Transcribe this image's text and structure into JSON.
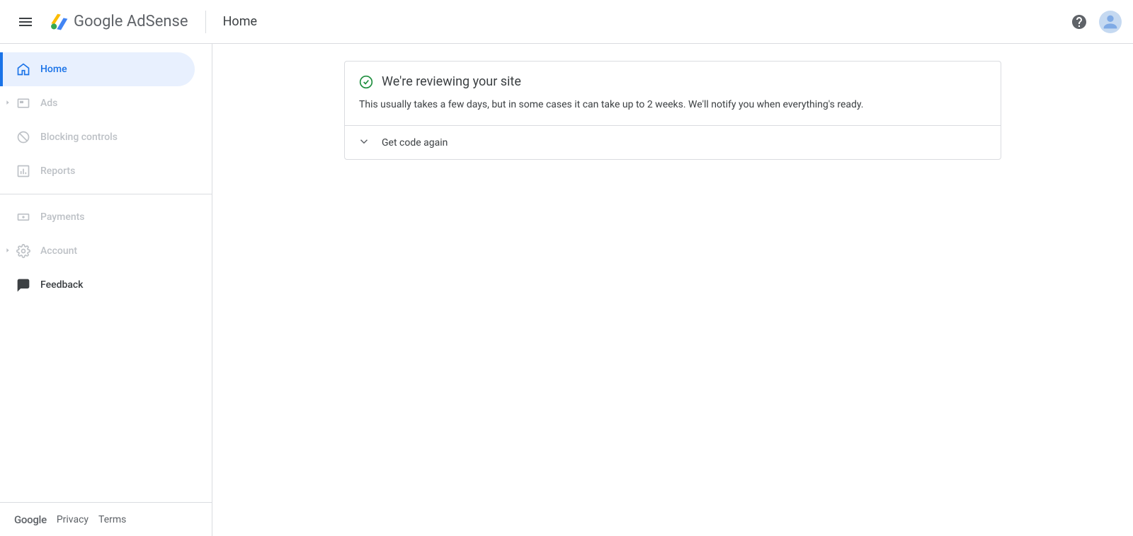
{
  "header": {
    "logo_text_primary": "Google",
    "logo_text_secondary": "AdSense",
    "page_title": "Home"
  },
  "sidebar": {
    "items": [
      {
        "label": "Home"
      },
      {
        "label": "Ads"
      },
      {
        "label": "Blocking controls"
      },
      {
        "label": "Reports"
      },
      {
        "label": "Payments"
      },
      {
        "label": "Account"
      },
      {
        "label": "Feedback"
      }
    ],
    "footer": {
      "google": "Google",
      "privacy": "Privacy",
      "terms": "Terms"
    }
  },
  "main": {
    "status_title": "We're reviewing your site",
    "status_desc": "This usually takes a few days, but in some cases it can take up to 2 weeks. We'll notify you when everything's ready.",
    "expand_label": "Get code again"
  }
}
